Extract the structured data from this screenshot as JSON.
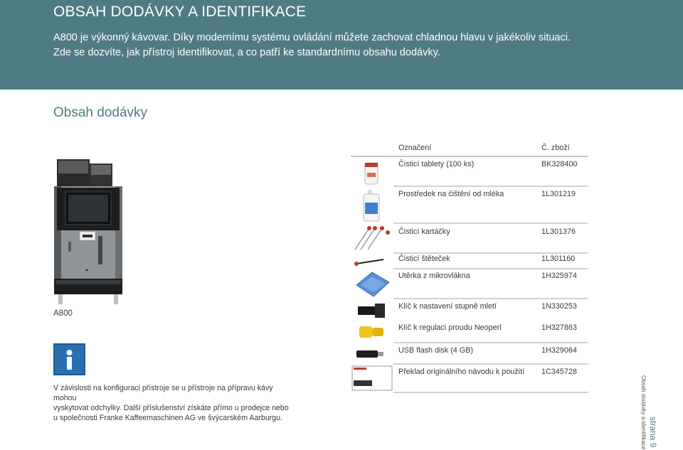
{
  "header": {
    "title": "OBSAH DODÁVKY A IDENTIFIKACE",
    "intro_line1": "A800 je výkonný kávovar. Díky modernímu systému ovládání můžete zachovat chladnou hlavu v jakékoliv situaci.",
    "intro_line2": "Zde se dozvíte, jak přístroj identifikovat, a co patří ke standardnímu obsahu dodávky."
  },
  "section": {
    "title": "Obsah dodávky"
  },
  "machine": {
    "label": "A800",
    "icon": "coffee-machine-illustration"
  },
  "info": {
    "icon": "info-icon",
    "text_line1": "V závislosti na konfiguraci přístroje se u přístroje na přípravu kávy mohou",
    "text_line2": "vyskytovat odchylky. Další příslušenství získáte přímo u prodejce nebo",
    "text_line3": "u společnosti Franke Kaffeemaschinen AG ve švýcarském Aarburgu."
  },
  "table": {
    "header": {
      "name": "Označení",
      "code": "Č. zboží"
    },
    "rows": [
      {
        "name": "Čisticí tablety (100 ks)",
        "code": "BK328400",
        "icon": "tablet-jar-icon"
      },
      {
        "name": "Prostředek na čištění od mléka",
        "code": "1L301219",
        "icon": "cleaner-bottle-icon"
      },
      {
        "name": "Čisticí kartáčky",
        "code": "1L301376",
        "icon": "brushes-icon"
      },
      {
        "name": "Čisticí štěteček",
        "code": "1L301160",
        "icon": "brush-icon"
      },
      {
        "name": "Utěrka z mikrovlákna",
        "code": "1H325974",
        "icon": "cloth-icon"
      },
      {
        "name": "Klíč k nastavení stupně mletí",
        "code": "1N330253",
        "icon": "grinder-key-icon"
      },
      {
        "name": "Klíč k regulaci proudu Neoperl",
        "code": "1H327863",
        "icon": "neoperl-key-icon"
      },
      {
        "name": "USB flash disk (4 GB)",
        "code": "1H329064",
        "icon": "usb-stick-icon"
      },
      {
        "name": "Překlad originálního návodu k použití",
        "code": "1C345728",
        "icon": "manual-icon"
      }
    ]
  },
  "footer": {
    "side_label": "Obsah dodávky a identifikace",
    "page_label": "strana 9"
  }
}
